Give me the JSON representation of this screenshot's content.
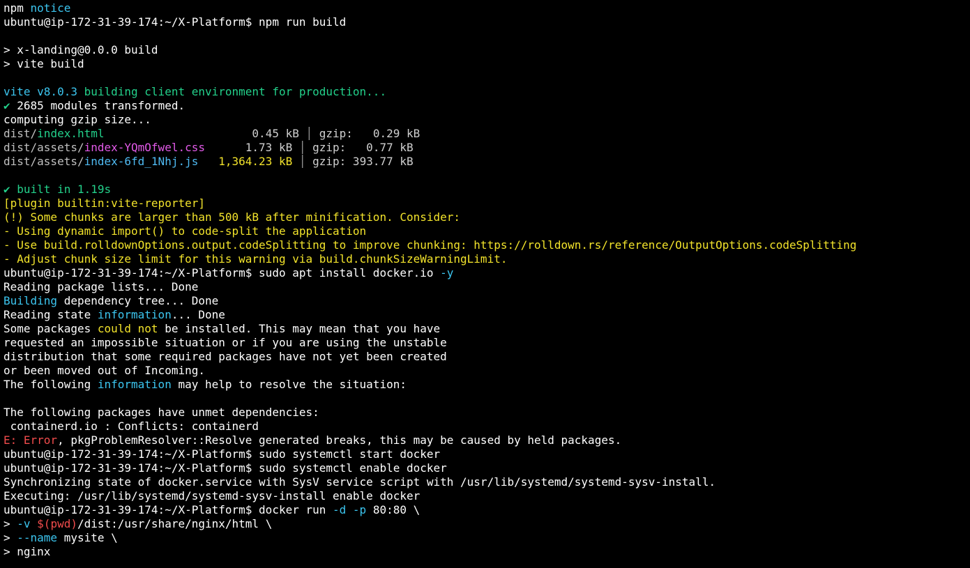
{
  "terminal": {
    "lines": [
      [
        {
          "t": "npm ",
          "c": "w"
        },
        {
          "t": "notice",
          "c": "cy"
        }
      ],
      [
        {
          "t": "ubuntu@ip-172-31-39-174:~/X-Platform$ npm run build",
          "c": "w"
        }
      ],
      [],
      [
        {
          "t": "> x-landing@0.0.0 build",
          "c": "w"
        }
      ],
      [
        {
          "t": "> vite build",
          "c": "w"
        }
      ],
      [],
      [
        {
          "t": "vite v8.0.3 ",
          "c": "cy"
        },
        {
          "t": "building client environment for production...",
          "c": "gr"
        }
      ],
      [
        {
          "t": "✔",
          "c": "gr"
        },
        {
          "t": " 2685 modules transformed.",
          "c": "w"
        }
      ],
      [
        {
          "t": "computing gzip size...",
          "c": "w"
        }
      ],
      [
        {
          "t": "dist/",
          "c": "gy"
        },
        {
          "t": "index.html",
          "c": "gr"
        },
        {
          "t": "                      0.45 kB ",
          "c": "sz"
        },
        {
          "t": "│",
          "c": "sep"
        },
        {
          "t": " gzip:   0.29 kB",
          "c": "sz"
        }
      ],
      [
        {
          "t": "dist/assets/",
          "c": "gy"
        },
        {
          "t": "index-YQmOfwel.css",
          "c": "mg"
        },
        {
          "t": "      1.73 kB ",
          "c": "sz"
        },
        {
          "t": "│",
          "c": "sep"
        },
        {
          "t": " gzip:   0.77 kB",
          "c": "sz"
        }
      ],
      [
        {
          "t": "dist/assets/",
          "c": "gy"
        },
        {
          "t": "index-6fd_1Nhj.js",
          "c": "bl"
        },
        {
          "t": "   1,364.23 kB ",
          "c": "szy"
        },
        {
          "t": "│",
          "c": "sep"
        },
        {
          "t": " gzip: 393.77 kB",
          "c": "sz"
        }
      ],
      [],
      [
        {
          "t": "✔ built in 1.19s",
          "c": "gr"
        }
      ],
      [
        {
          "t": "[plugin builtin:vite-reporter]",
          "c": "ye"
        }
      ],
      [
        {
          "t": "(!) Some chunks are larger than 500 kB after minification. Consider:",
          "c": "ye"
        }
      ],
      [
        {
          "t": "- Using dynamic import() to code-split the application",
          "c": "ye"
        }
      ],
      [
        {
          "t": "- Use build.rolldownOptions.output.codeSplitting to improve chunking: https://rolldown.rs/reference/OutputOptions.codeSplitting",
          "c": "ye"
        }
      ],
      [
        {
          "t": "- Adjust chunk size limit for this warning via build.chunkSizeWarningLimit.",
          "c": "ye"
        }
      ],
      [
        {
          "t": "ubuntu@ip-172-31-39-174:~/X-Platform$ sudo apt install docker.io ",
          "c": "w"
        },
        {
          "t": "-y",
          "c": "cy"
        }
      ],
      [
        {
          "t": "Reading package lists... Done",
          "c": "w"
        }
      ],
      [
        {
          "t": "Building",
          "c": "cy"
        },
        {
          "t": " dependency tree... Done",
          "c": "w"
        }
      ],
      [
        {
          "t": "Reading state ",
          "c": "w"
        },
        {
          "t": "information",
          "c": "cy"
        },
        {
          "t": "... Done",
          "c": "w"
        }
      ],
      [
        {
          "t": "Some packages ",
          "c": "w"
        },
        {
          "t": "could not",
          "c": "ye"
        },
        {
          "t": " be installed. This may mean that you have",
          "c": "w"
        }
      ],
      [
        {
          "t": "requested an impossible situation or if you are using the unstable",
          "c": "w"
        }
      ],
      [
        {
          "t": "distribution that some required packages have not yet been created",
          "c": "w"
        }
      ],
      [
        {
          "t": "or been moved out of Incoming.",
          "c": "w"
        }
      ],
      [
        {
          "t": "The following ",
          "c": "w"
        },
        {
          "t": "information",
          "c": "cy"
        },
        {
          "t": " may help to resolve the situation:",
          "c": "w"
        }
      ],
      [],
      [
        {
          "t": "The following packages have unmet dependencies:",
          "c": "w"
        }
      ],
      [
        {
          "t": " containerd.io : Conflicts: containerd",
          "c": "w"
        }
      ],
      [
        {
          "t": "E: Error",
          "c": "rd"
        },
        {
          "t": ", pkgProblemResolver::Resolve generated breaks, this may be caused by held packages.",
          "c": "w"
        }
      ],
      [
        {
          "t": "ubuntu@ip-172-31-39-174:~/X-Platform$ sudo systemctl start docker",
          "c": "w"
        }
      ],
      [
        {
          "t": "ubuntu@ip-172-31-39-174:~/X-Platform$ sudo systemctl enable docker",
          "c": "w"
        }
      ],
      [
        {
          "t": "Synchronizing state of docker.service with SysV service script with /usr/lib/systemd/systemd-sysv-install.",
          "c": "w"
        }
      ],
      [
        {
          "t": "Executing: /usr/lib/systemd/systemd-sysv-install enable docker",
          "c": "w"
        }
      ],
      [
        {
          "t": "ubuntu@ip-172-31-39-174:~/X-Platform$ docker run ",
          "c": "w"
        },
        {
          "t": "-d -p",
          "c": "cy"
        },
        {
          "t": " 80:80 \\",
          "c": "w"
        }
      ],
      [
        {
          "t": "> ",
          "c": "w"
        },
        {
          "t": "-v",
          "c": "cy"
        },
        {
          "t": " ",
          "c": "w"
        },
        {
          "t": "$(pwd)",
          "c": "rd"
        },
        {
          "t": "/dist:/usr/share/nginx/html \\",
          "c": "w"
        }
      ],
      [
        {
          "t": "> ",
          "c": "w"
        },
        {
          "t": "--name",
          "c": "cy"
        },
        {
          "t": " mysite \\",
          "c": "w"
        }
      ],
      [
        {
          "t": "> nginx",
          "c": "w"
        }
      ]
    ]
  },
  "colors": {
    "background": "#000000",
    "text": "#ffffff",
    "cyan": "#3cc6f0",
    "green": "#23d18b",
    "yellow": "#f2e32b",
    "magenta": "#e25ae8",
    "blue": "#4fbaf2",
    "red": "#f14c4c"
  }
}
